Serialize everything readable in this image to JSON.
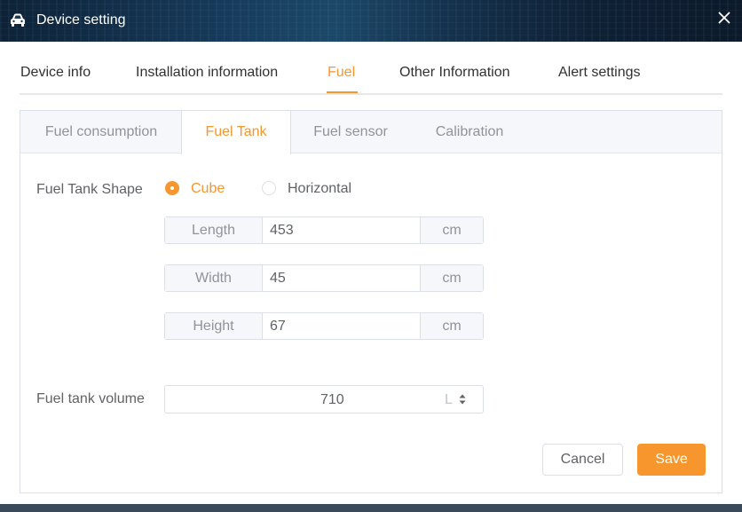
{
  "window": {
    "title": "Device setting",
    "title_icon": "car-icon",
    "close_icon": "close-icon"
  },
  "main_tabs": [
    {
      "label": "Device info",
      "active": false
    },
    {
      "label": "Installation information",
      "active": false
    },
    {
      "label": "Fuel",
      "active": true
    },
    {
      "label": "Other Information",
      "active": false
    },
    {
      "label": "Alert settings",
      "active": false
    }
  ],
  "sub_tabs": [
    {
      "label": "Fuel consumption",
      "active": false
    },
    {
      "label": "Fuel Tank",
      "active": true
    },
    {
      "label": "Fuel sensor",
      "active": false
    },
    {
      "label": "Calibration",
      "active": false
    }
  ],
  "form": {
    "shape_label": "Fuel Tank Shape",
    "shape_options": [
      {
        "label": "Cube",
        "checked": true
      },
      {
        "label": "Horizontal",
        "checked": false
      }
    ],
    "dimensions": [
      {
        "label": "Length",
        "value": "453",
        "unit": "cm"
      },
      {
        "label": "Width",
        "value": "45",
        "unit": "cm"
      },
      {
        "label": "Height",
        "value": "67",
        "unit": "cm"
      }
    ],
    "volume_label": "Fuel tank volume",
    "volume_value": "710",
    "volume_unit": "L"
  },
  "buttons": {
    "cancel": "Cancel",
    "save": "Save"
  },
  "colors": {
    "accent": "#f7962d",
    "title_bar": "#15324d"
  }
}
